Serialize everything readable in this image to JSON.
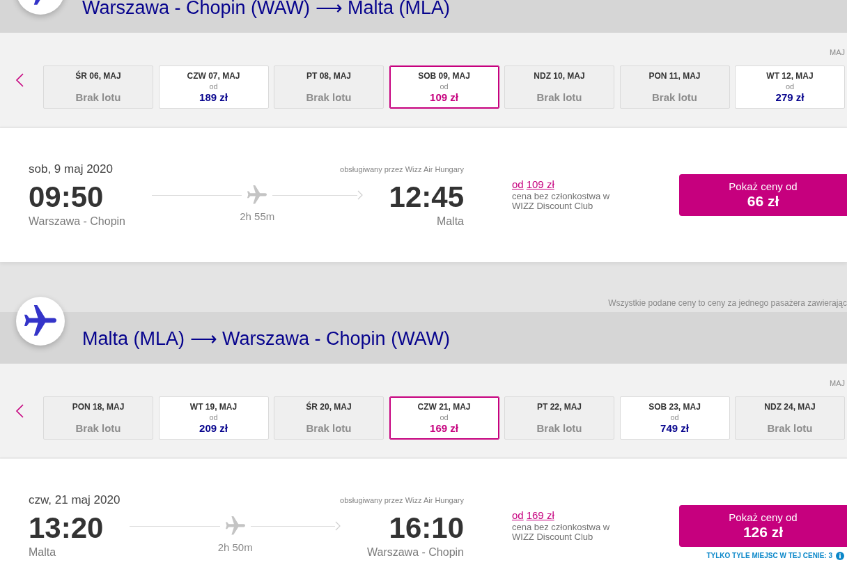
{
  "journeys": [
    {
      "route": {
        "origin": "Warszawa - Chopin (WAW)",
        "arrow": "⟶",
        "destination": "Malta (MLA)"
      },
      "month": "MAJ",
      "dates": [
        {
          "kind": "no_flight",
          "day": "ŚR 06, MAJ",
          "status": "Brak lotu",
          "selected": false
        },
        {
          "kind": "fare",
          "day": "CZW 07, MAJ",
          "prefix": "od",
          "price": "189 zł",
          "selected": false
        },
        {
          "kind": "no_flight",
          "day": "PT 08, MAJ",
          "status": "Brak lotu",
          "selected": false
        },
        {
          "kind": "fare",
          "day": "SOB 09, MAJ",
          "prefix": "od",
          "price": "109 zł",
          "selected": true
        },
        {
          "kind": "no_flight",
          "day": "NDZ 10, MAJ",
          "status": "Brak lotu",
          "selected": false
        },
        {
          "kind": "no_flight",
          "day": "PON 11, MAJ",
          "status": "Brak lotu",
          "selected": false
        },
        {
          "kind": "fare",
          "day": "WT 12, MAJ",
          "prefix": "od",
          "price": "279 zł",
          "selected": false
        }
      ],
      "flight": {
        "date": "sob, 9 maj 2020",
        "operator": "obsługiwany przez Wizz Air Hungary",
        "departure": {
          "time": "09:50",
          "airport": "Warszawa - Chopin"
        },
        "duration": "2h 55m",
        "arrival": {
          "time": "12:45",
          "airport": "Malta"
        },
        "fare": {
          "prefix": "od",
          "price": "109 zł",
          "note": "cena bez członkostwa w WIZZ Discount Club"
        },
        "button": {
          "label": "Pokaż ceny od",
          "price": "66 zł"
        }
      }
    },
    {
      "notice": "Wszystkie podane ceny to ceny za jednego pasażera zawierając",
      "route": {
        "origin": "Malta (MLA)",
        "arrow": "⟶",
        "destination": "Warszawa - Chopin (WAW)"
      },
      "month": "MAJ",
      "dates": [
        {
          "kind": "no_flight",
          "day": "PON 18, MAJ",
          "status": "Brak lotu",
          "selected": false
        },
        {
          "kind": "fare",
          "day": "WT 19, MAJ",
          "prefix": "od",
          "price": "209 zł",
          "selected": false
        },
        {
          "kind": "no_flight",
          "day": "ŚR 20, MAJ",
          "status": "Brak lotu",
          "selected": false
        },
        {
          "kind": "fare",
          "day": "CZW 21, MAJ",
          "prefix": "od",
          "price": "169 zł",
          "selected": true
        },
        {
          "kind": "no_flight",
          "day": "PT 22, MAJ",
          "status": "Brak lotu",
          "selected": false
        },
        {
          "kind": "fare",
          "day": "SOB 23, MAJ",
          "prefix": "od",
          "price": "749 zł",
          "selected": false
        },
        {
          "kind": "no_flight",
          "day": "NDZ 24, MAJ",
          "status": "Brak lotu",
          "selected": false
        }
      ],
      "flight": {
        "date": "czw, 21 maj 2020",
        "operator": "obsługiwany przez Wizz Air Hungary",
        "departure": {
          "time": "13:20",
          "airport": "Malta"
        },
        "duration": "2h 50m",
        "arrival": {
          "time": "16:10",
          "airport": "Warszawa - Chopin"
        },
        "fare": {
          "prefix": "od",
          "price": "169 zł",
          "note": "cena bez członkostwa w WIZZ Discount Club"
        },
        "button": {
          "label": "Pokaż ceny od",
          "price": "126 zł"
        },
        "seats_notice": "TYLKO TYLE MIEJSC W TEJ CENIE: 3"
      }
    }
  ]
}
